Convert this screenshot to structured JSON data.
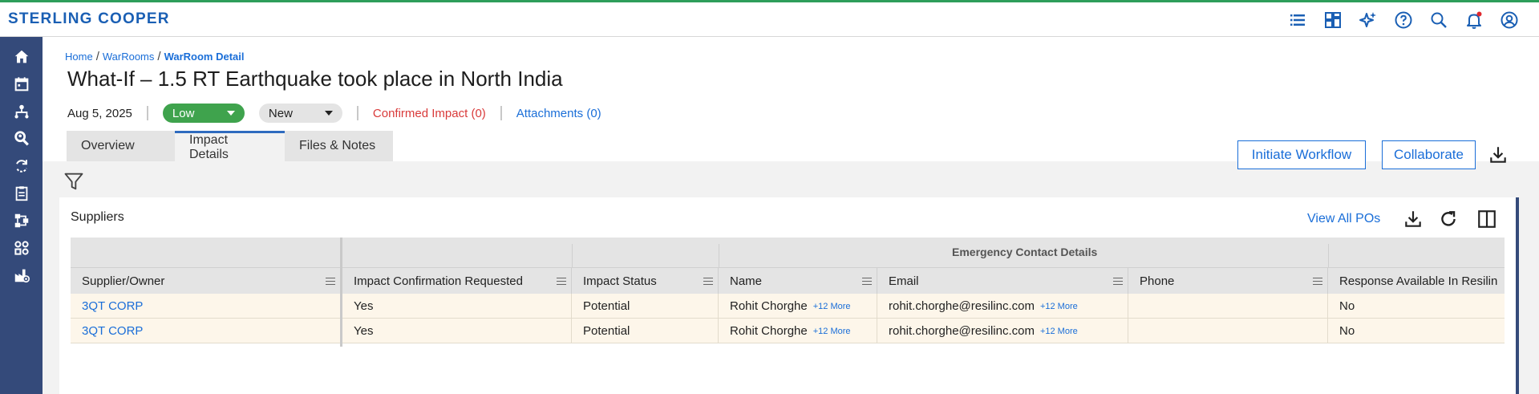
{
  "app": {
    "brand": "STERLING COOPER"
  },
  "topbar_icons": [
    "list-icon",
    "dashboard-icon",
    "ai-sparkle-icon",
    "help-icon",
    "search-icon",
    "bell-icon",
    "user-icon"
  ],
  "sidebar_icons": [
    "home-icon",
    "calendar-icon",
    "hierarchy-icon",
    "search-people-icon",
    "sync-icon",
    "clipboard-icon",
    "workflow-icon",
    "grid-icon",
    "factory-icon"
  ],
  "breadcrumb": {
    "home": "Home",
    "warrooms": "WarRooms",
    "current": "WarRoom Detail"
  },
  "page": {
    "title": "What-If – 1.5 RT Earthquake took place in North India",
    "date": "Aug 5, 2025",
    "severity": "Low",
    "status": "New",
    "confirmed_impact": "Confirmed Impact (0)",
    "attachments": "Attachments (0)"
  },
  "colors": {
    "brand": "#1a5fb4",
    "severity_low": "#3fa34d",
    "link": "#1a6ed8",
    "danger": "#d93a3a",
    "sidebar": "#344a7a"
  },
  "tabs": [
    {
      "label": "Overview",
      "active": false
    },
    {
      "label": "Impact Details",
      "active": true
    },
    {
      "label": "Files & Notes",
      "active": false
    }
  ],
  "actions": {
    "initiate_workflow": "Initiate Workflow",
    "collaborate": "Collaborate"
  },
  "suppliers": {
    "title": "Suppliers",
    "view_all": "View All POs",
    "group_header": "Emergency Contact Details",
    "columns": [
      "Supplier/Owner",
      "Impact Confirmation Requested",
      "Impact Status",
      "Name",
      "Email",
      "Phone",
      "Response Available In Resilin"
    ],
    "rows": [
      {
        "supplier": "3QT CORP",
        "confirmation": "Yes",
        "status": "Potential",
        "name": "Rohit Chorghe",
        "name_more": "+12 More",
        "email": "rohit.chorghe@resilinc.com",
        "email_more": "+12 More",
        "phone": "",
        "response": "No"
      },
      {
        "supplier": "3QT CORP",
        "confirmation": "Yes",
        "status": "Potential",
        "name": "Rohit Chorghe",
        "name_more": "+12 More",
        "email": "rohit.chorghe@resilinc.com",
        "email_more": "+12 More",
        "phone": "",
        "response": "No"
      }
    ]
  }
}
